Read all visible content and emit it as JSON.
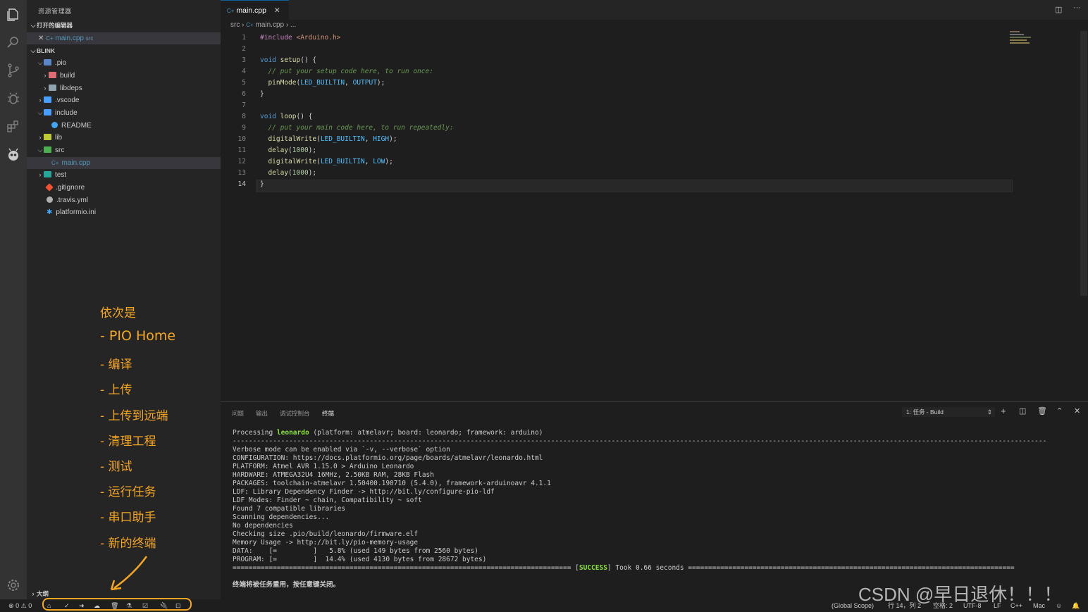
{
  "explorer": {
    "title": "资源管理器",
    "open_editors_label": "打开的编辑器",
    "open_editor_file": "main.cpp",
    "open_editor_dir": "src",
    "project_label": "BLINK",
    "outline_label": "大纲"
  },
  "tree": [
    {
      "label": ".pio",
      "icon": "folder-open",
      "color": "#5b87c9"
    },
    {
      "label": "build",
      "icon": "folder",
      "color": "#e06c75"
    },
    {
      "label": "libdeps",
      "icon": "folder",
      "color": "#90a4ae"
    },
    {
      "label": ".vscode",
      "icon": "folder",
      "color": "#4a9eff"
    },
    {
      "label": "include",
      "icon": "folder-open",
      "color": "#4a9eff"
    },
    {
      "label": "README",
      "icon": "info",
      "color": "#42a5f5"
    },
    {
      "label": "lib",
      "icon": "folder",
      "color": "#c0ca33"
    },
    {
      "label": "src",
      "icon": "folder-open",
      "color": "#4caf50"
    },
    {
      "label": "main.cpp",
      "icon": "cpp",
      "color": "#519aba"
    },
    {
      "label": "test",
      "icon": "folder",
      "color": "#26a69a"
    },
    {
      "label": ".gitignore",
      "icon": "git",
      "color": "#f05133"
    },
    {
      "label": ".travis.yml",
      "icon": "travis",
      "color": "#cccccc"
    },
    {
      "label": "platformio.ini",
      "icon": "gear",
      "color": "#42a5f5"
    }
  ],
  "editor": {
    "tab_label": "main.cpp",
    "breadcrumb_src": "src",
    "breadcrumb_file": "main.cpp",
    "breadcrumb_more": "...",
    "line_numbers": [
      "1",
      "2",
      "3",
      "4",
      "5",
      "6",
      "7",
      "8",
      "9",
      "10",
      "11",
      "12",
      "13",
      "14"
    ],
    "lines": {
      "l1a": "#include ",
      "l1b": "<Arduino.h>",
      "l3a": "void ",
      "l3b": "setup",
      "l3c": "() {",
      "l4": "  // put your setup code here, to run once:",
      "l5a": "  pinMode",
      "l5b": "(",
      "l5c": "LED_BUILTIN",
      "l5d": ", ",
      "l5e": "OUTPUT",
      "l5f": ");",
      "l6": "}",
      "l8a": "void ",
      "l8b": "loop",
      "l8c": "() {",
      "l9": "  // put your main code here, to run repeatedly:",
      "l10a": "  digitalWrite",
      "l10b": "(",
      "l10c": "LED_BUILTIN",
      "l10d": ", ",
      "l10e": "HIGH",
      "l10f": ");",
      "l11a": "  delay",
      "l11b": "(",
      "l11c": "1000",
      "l11d": ");",
      "l12a": "  digitalWrite",
      "l12b": "(",
      "l12c": "LED_BUILTIN",
      "l12d": ", ",
      "l12e": "LOW",
      "l12f": ");",
      "l13a": "  delay",
      "l13b": "(",
      "l13c": "1000",
      "l13d": ");",
      "l14": "}"
    }
  },
  "panel": {
    "tabs": [
      "问题",
      "输出",
      "调试控制台",
      "终端"
    ],
    "task_select": "1: 任务 - Build",
    "terminal": [
      "Processing leonardo (platform: atmelavr; board: leonardo; framework: arduino)",
      "----------------------------------------------------------------------------------------------------------------------------------------------------------------------------------------------------------",
      "Verbose mode can be enabled via `-v, --verbose` option",
      "CONFIGURATION: https://docs.platformio.org/page/boards/atmelavr/leonardo.html",
      "PLATFORM: Atmel AVR 1.15.0 > Arduino Leonardo",
      "HARDWARE: ATMEGA32U4 16MHz, 2.50KB RAM, 28KB Flash",
      "PACKAGES: toolchain-atmelavr 1.50400.190710 (5.4.0), framework-arduinoavr 4.1.1",
      "LDF: Library Dependency Finder -> http://bit.ly/configure-pio-ldf",
      "LDF Modes: Finder ~ chain, Compatibility ~ soft",
      "Found 7 compatible libraries",
      "Scanning dependencies...",
      "No dependencies",
      "Checking size .pio/build/leonardo/firmware.elf",
      "Memory Usage -> http://bit.ly/pio-memory-usage",
      "DATA:    [=         ]   5.8% (used 149 bytes from 2560 bytes)",
      "PROGRAM: [=         ]  14.4% (used 4130 bytes from 28672 bytes)"
    ],
    "processing_prefix": "Processing ",
    "processing_env": "leonardo",
    "processing_rest": " (platform: atmelavr; board: leonardo; framework: arduino)",
    "success_left": "==================================================================================== [",
    "success_word": "SUCCESS",
    "success_right": "] Took 0.66 seconds =================================================================================",
    "closing_msg": "终端将被任务重用，按任意键关闭。"
  },
  "status": {
    "errors": "0",
    "warnings": "0",
    "scope": "(Global Scope)",
    "position": "行 14，列 2",
    "spaces": "空格: 2",
    "encoding": "UTF-8",
    "eol": "LF",
    "language": "C++",
    "platform": "Mac"
  },
  "annotation": {
    "lines": [
      "依次是",
      "- PIO Home",
      "- 编译",
      "- 上传",
      "- 上传到远端",
      "- 清理工程",
      "- 测试",
      "- 运行任务",
      "- 串口助手",
      "- 新的终端"
    ]
  },
  "watermark": "CSDN @早日退休！！！",
  "colors": {
    "accent": "#f5a623",
    "tab_border": "#0e639c"
  }
}
